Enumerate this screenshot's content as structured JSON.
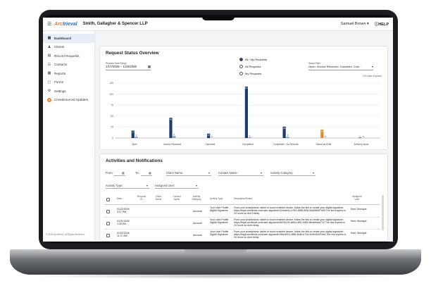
{
  "header": {
    "logo_prefix": "Arc",
    "logo_suffix": "trieval",
    "firm_name": "Smith, Gallagher & Spencer LLP",
    "user_name": "Samuel Brown",
    "help_label": "HELP"
  },
  "sidebar": {
    "items": [
      {
        "label": "Dashboard",
        "icon": "dashboard-icon"
      },
      {
        "label": "Clients",
        "icon": "users-icon"
      },
      {
        "label": "Record Requests",
        "icon": "document-icon"
      },
      {
        "label": "Contacts",
        "icon": "contacts-icon"
      },
      {
        "label": "Reports",
        "icon": "reports-icon"
      },
      {
        "label": "Forms",
        "icon": "forms-icon"
      },
      {
        "label": "Settings",
        "icon": "gear-icon"
      },
      {
        "label": "Crowdsourced Updates",
        "icon": "crowd-icon"
      }
    ],
    "copyright": "© 2026 Arctrieval | All Rights Reserved."
  },
  "overview": {
    "title": "Request Status Overview",
    "date_label": "Request Date Range",
    "date_start": "1/17/2025",
    "date_sep": "–",
    "date_end": "1/25/2026",
    "radio_options": [
      "All / My Requests",
      "All Requests",
      "My Requests"
    ],
    "radio_selected": 0,
    "status_filter_label": "Status Filter",
    "status_filter_value": "Open, Invoice Received, Canceled, Com...",
    "total_label": "243 total requests"
  },
  "chart_data": {
    "type": "bar",
    "categories": [
      "Open",
      "Invoice Received",
      "Canceled",
      "Completed",
      "Completed - No Records",
      "Saved as Draft",
      "Delivery Issue"
    ],
    "series": [
      {
        "values": [
          17,
          46,
          10,
          117,
          26,
          19,
          1
        ],
        "color": "#1e3a6e"
      },
      {
        "values": [
          3,
          5,
          0,
          2,
          3,
          0,
          0
        ],
        "color": "#8ca3c7"
      }
    ],
    "highlight": {
      "category_index": 5,
      "series_index": 0,
      "color": "#e58a2c"
    },
    "yticks": [
      0,
      25,
      50,
      75,
      100,
      125
    ],
    "ylim": [
      0,
      125
    ],
    "grid": true
  },
  "activities": {
    "title": "Activities and Notifications",
    "from_label": "From:",
    "to_label": "To:",
    "client_name_label": "Client Name:",
    "contact_name_label": "Contact Name:",
    "activity_category_label": "Activity Category:",
    "activity_type_label": "Activity Type:",
    "assigned_user_label": "Assigned User:",
    "columns": [
      "Date",
      "Request ID",
      "Client Name",
      "Contact Name",
      "Activity Category",
      "Activity Type",
      "Description/Notes",
      "Assigned User"
    ],
    "rows": [
      {
        "date": "01/21/2026",
        "time": "3:27 PM",
        "category": "Account",
        "type": "Your User Profile Digital Signature",
        "notes": "From your smartphone, tablet or touch enabled device, follow the link to create your digital signature: https://legal.arctrieval.com/user-signature/42dcab41-e769-4885-8f26-5d4d5b0f7d95 The link expires in 24 hours so don't delay.",
        "user": "Kent, Monique"
      },
      {
        "date": "01/21/2026",
        "time": "1:28 PM",
        "category": "Account",
        "type": "Your User Profile Digital Signature",
        "notes": "From your smartphone, tablet or touch enabled device, follow the link to create your digital signature: https://legal.arctrieval.com/user-signature/f622e130-a65d-4f91-9d06-f6bde6ead712 The link expires in 24 hours so dont delay.",
        "user": "Kent, Monique"
      },
      {
        "date": "01/21/2026",
        "time": "11:27 AM",
        "category": "Account",
        "type": "Your User Profile Digital Signature",
        "notes": "From your smartphone, tablet or touch enabled device, follow the link to create your digital signature: https://legal.arctrieval.com/user-signature/35a4b911-d58f-4b6b-b71d-9c0ec5d37ee6 The link expires in 24 hours so dont delay.",
        "user": "Kent, Monique"
      }
    ]
  }
}
